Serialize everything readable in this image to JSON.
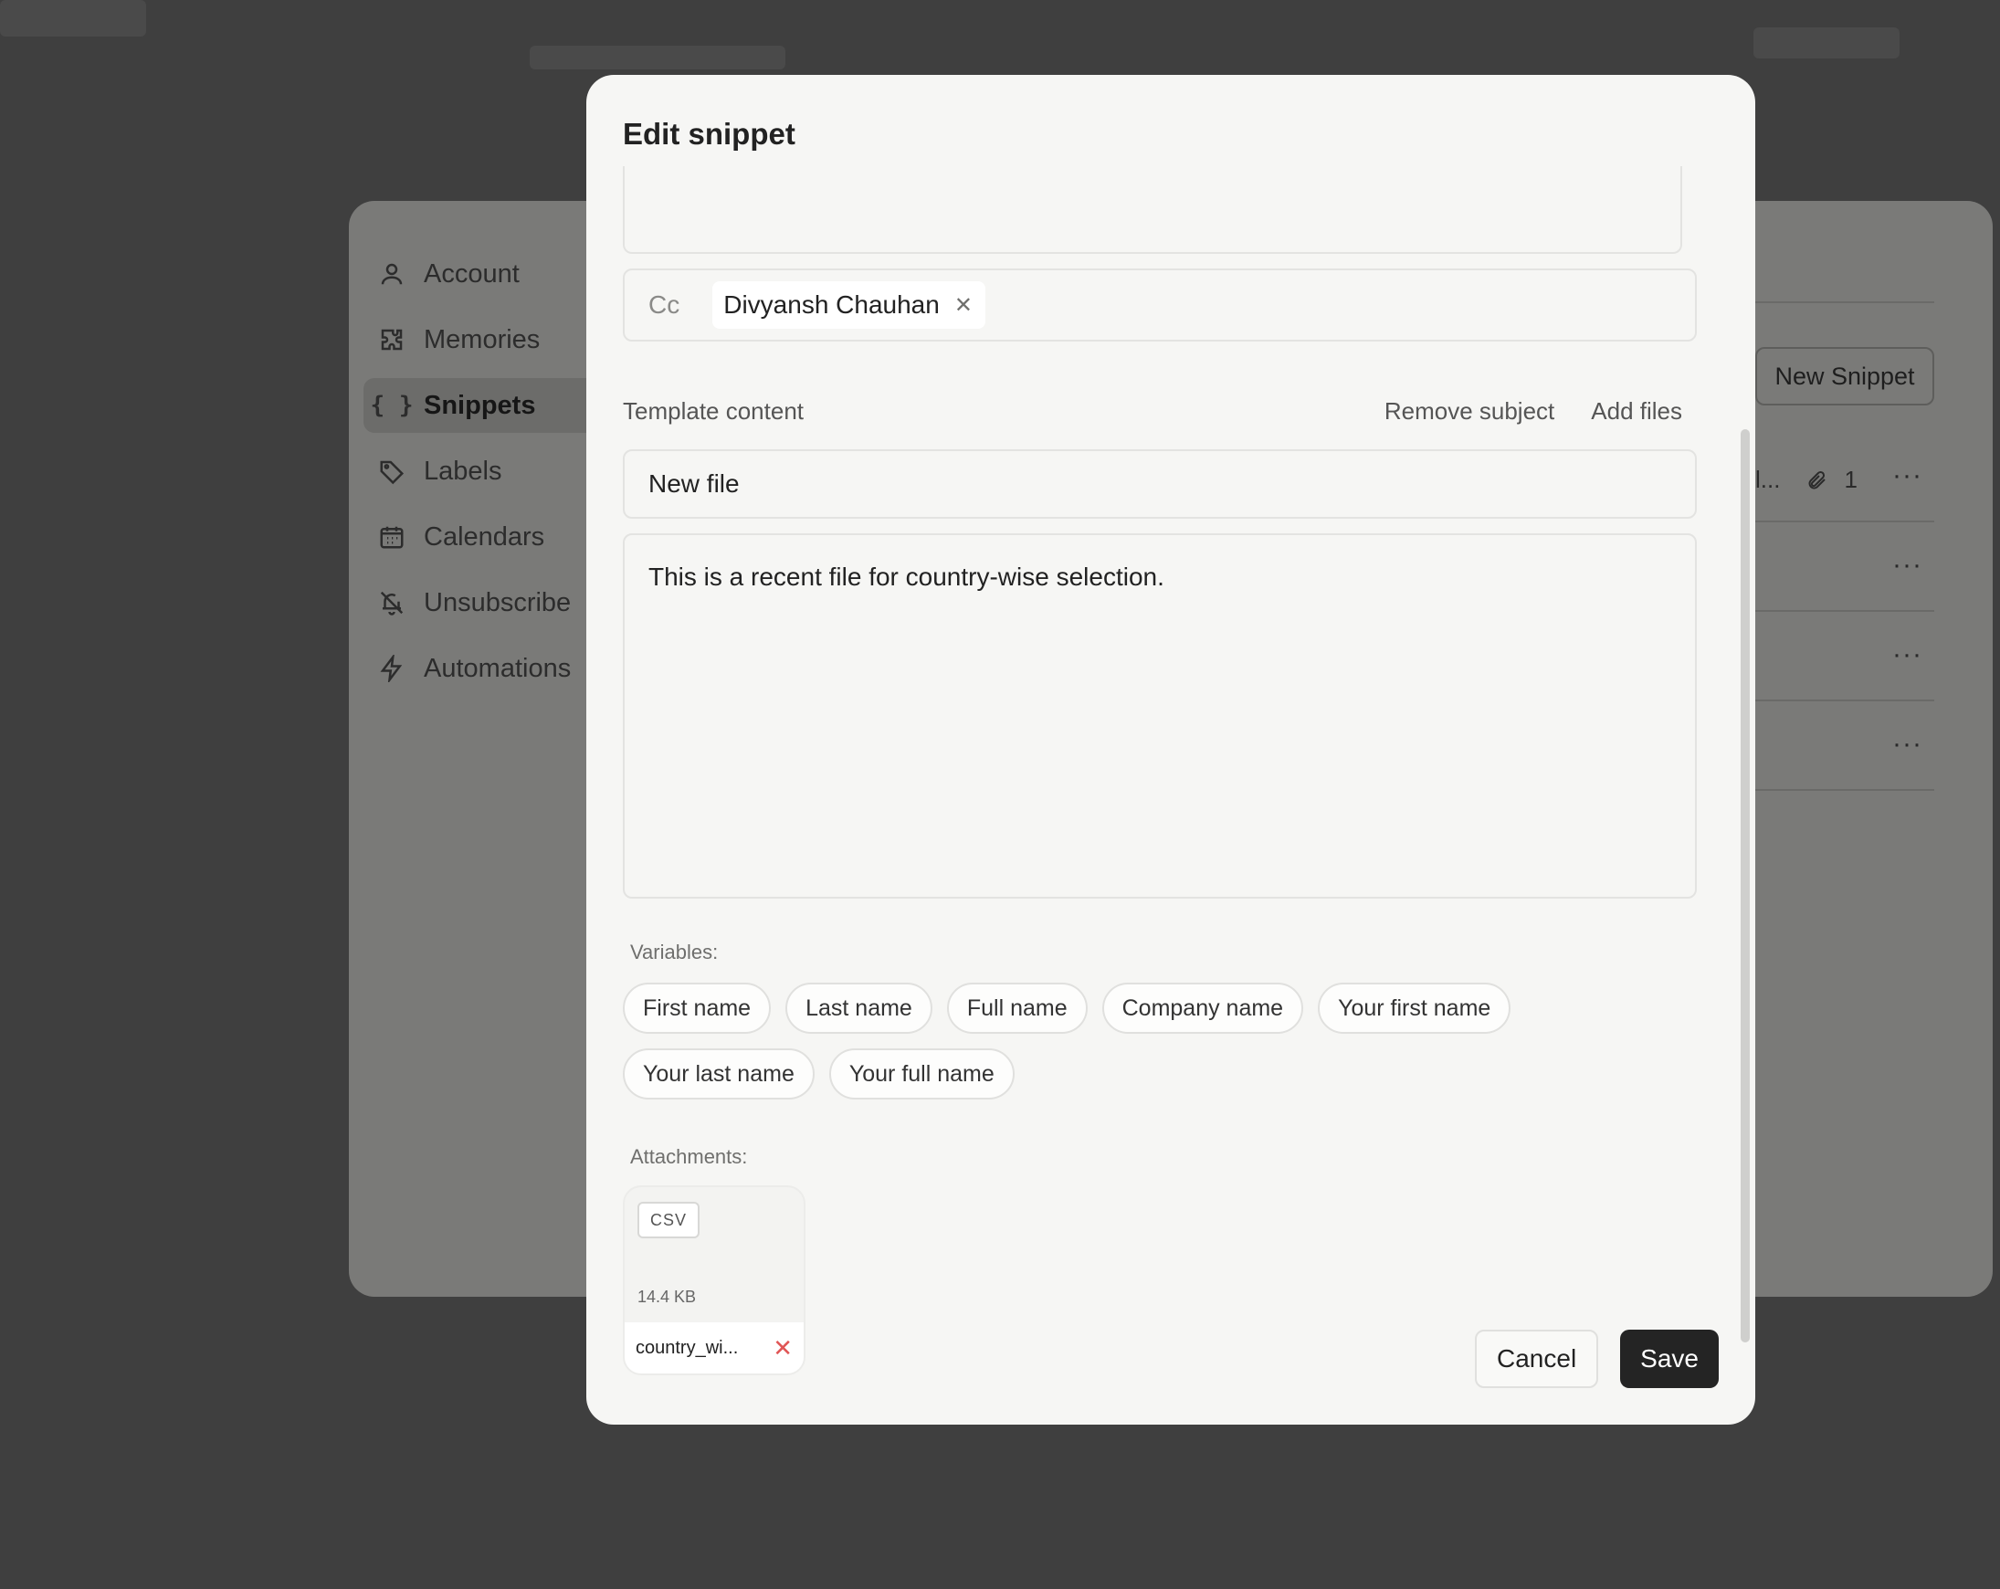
{
  "settings_nav": {
    "items": [
      {
        "label": "Account",
        "icon": "user-icon"
      },
      {
        "label": "Memories",
        "icon": "puzzle-icon"
      },
      {
        "label": "Snippets",
        "icon": "braces-icon",
        "active": true
      },
      {
        "label": "Labels",
        "icon": "tag-icon"
      },
      {
        "label": "Calendars",
        "icon": "calendar-icon"
      },
      {
        "label": "Unsubscribe",
        "icon": "bell-off-icon"
      },
      {
        "label": "Automations",
        "icon": "bolt-icon"
      }
    ]
  },
  "snippets_list": {
    "new_snippet_label": "New Snippet",
    "first_row_attachment_count": "1",
    "first_row_truncated_text": "l..."
  },
  "modal": {
    "title": "Edit snippet",
    "cc": {
      "label": "Cc",
      "recipients": [
        "Divyansh Chauhan"
      ]
    },
    "template_content": {
      "label": "Template content",
      "remove_subject_label": "Remove subject",
      "add_files_label": "Add files",
      "subject_value": "New file",
      "body_value": "This is a recent file for country-wise selection."
    },
    "variables": {
      "label": "Variables:",
      "items": [
        "First name",
        "Last name",
        "Full name",
        "Company name",
        "Your first name",
        "Your last name",
        "Your full name"
      ]
    },
    "attachments": {
      "label": "Attachments:",
      "items": [
        {
          "type": "CSV",
          "size": "14.4 KB",
          "name": "country_wi..."
        }
      ]
    },
    "buttons": {
      "cancel": "Cancel",
      "save": "Save"
    }
  },
  "colors": {
    "overlay": "#444444",
    "modal_bg": "#f6f6f4",
    "save_button": "#242424",
    "remove_x": "#e05555"
  }
}
